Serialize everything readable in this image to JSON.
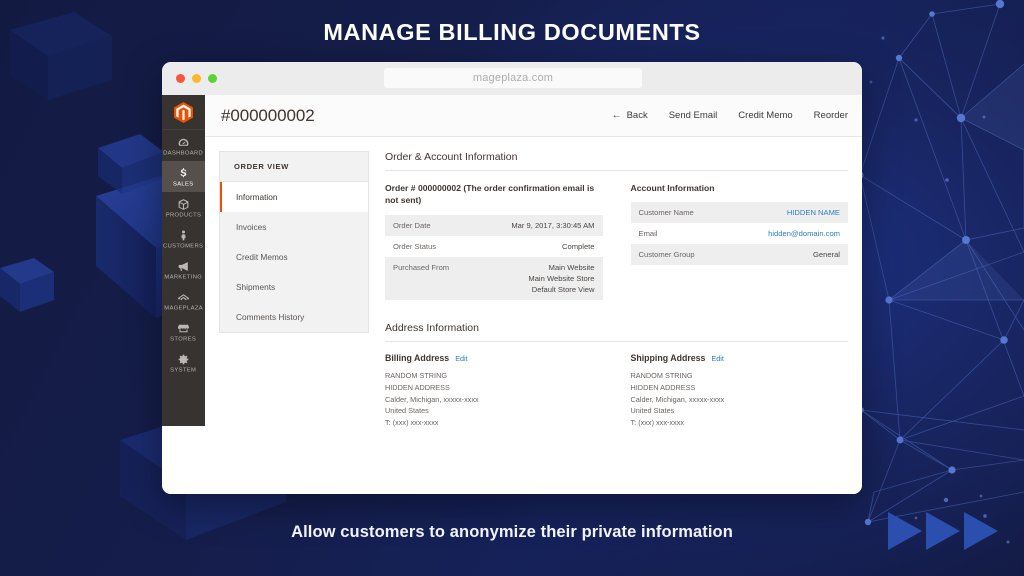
{
  "headline": "MANAGE BILLING DOCUMENTS",
  "caption": "Allow customers to anonymize their private information",
  "browser": {
    "url": "mageplaza.com",
    "url_placeholder": "mageplaza.com"
  },
  "sidenav": {
    "logo": "magento-logo-icon",
    "items": [
      {
        "label": "DASHBOARD",
        "icon": "dashboard-icon",
        "active": false
      },
      {
        "label": "SALES",
        "icon": "dollar-icon",
        "active": true
      },
      {
        "label": "PRODUCTS",
        "icon": "box-icon",
        "active": false
      },
      {
        "label": "CUSTOMERS",
        "icon": "person-icon",
        "active": false
      },
      {
        "label": "MARKETING",
        "icon": "megaphone-icon",
        "active": false
      },
      {
        "label": "MAGEPLAZA",
        "icon": "arch-icon",
        "active": false
      },
      {
        "label": "STORES",
        "icon": "store-icon",
        "active": false
      },
      {
        "label": "SYSTEM",
        "icon": "gear-icon",
        "active": false
      }
    ]
  },
  "header": {
    "order_id": "#000000002",
    "actions": {
      "back": "Back",
      "send_email": "Send Email",
      "credit_memo": "Credit Memo",
      "reorder": "Reorder"
    }
  },
  "order_view": {
    "title": "ORDER VIEW",
    "items": [
      {
        "label": "Information",
        "active": true
      },
      {
        "label": "Invoices",
        "active": false
      },
      {
        "label": "Credit Memos",
        "active": false
      },
      {
        "label": "Shipments",
        "active": false
      },
      {
        "label": "Comments History",
        "active": false
      }
    ]
  },
  "order_account": {
    "section_title": "Order & Account Information",
    "order": {
      "title": "Order # 000000002 (The order confirmation email is not sent)",
      "rows": [
        {
          "key": "Order Date",
          "value": "Mar 9, 2017, 3:30:45 AM",
          "link": false
        },
        {
          "key": "Order Status",
          "value": "Complete",
          "link": false
        },
        {
          "key": "Purchased From",
          "value": "Main Website\nMain Website Store\nDefault Store View",
          "link": false
        }
      ]
    },
    "account": {
      "title": "Account Information",
      "rows": [
        {
          "key": "Customer Name",
          "value": "HIDDEN NAME",
          "link": true
        },
        {
          "key": "Email",
          "value": "hidden@domain.com",
          "link": true
        },
        {
          "key": "Customer Group",
          "value": "General",
          "link": false
        }
      ]
    }
  },
  "address": {
    "section_title": "Address Information",
    "edit_label": "Edit",
    "billing": {
      "title": "Billing Address",
      "lines": [
        "RANDOM STRING",
        "HIDDEN ADDRESS",
        "Calder, Michigan, xxxxx-xxxx",
        "United States",
        "T: (xxx) xxx-xxxx"
      ]
    },
    "shipping": {
      "title": "Shipping Address",
      "lines": [
        "RANDOM STRING",
        "HIDDEN ADDRESS",
        "Calder, Michigan, xxxxx-xxxx",
        "United States",
        "T: (xxx) xxx-xxxx"
      ]
    }
  },
  "colors": {
    "background_deep": "#141c46",
    "background_mid": "#1d3080",
    "magento_orange": "#eb5202",
    "sidebar_dark": "#373330",
    "link_blue": "#2a7fc1",
    "headline_white": "#ffffff"
  }
}
